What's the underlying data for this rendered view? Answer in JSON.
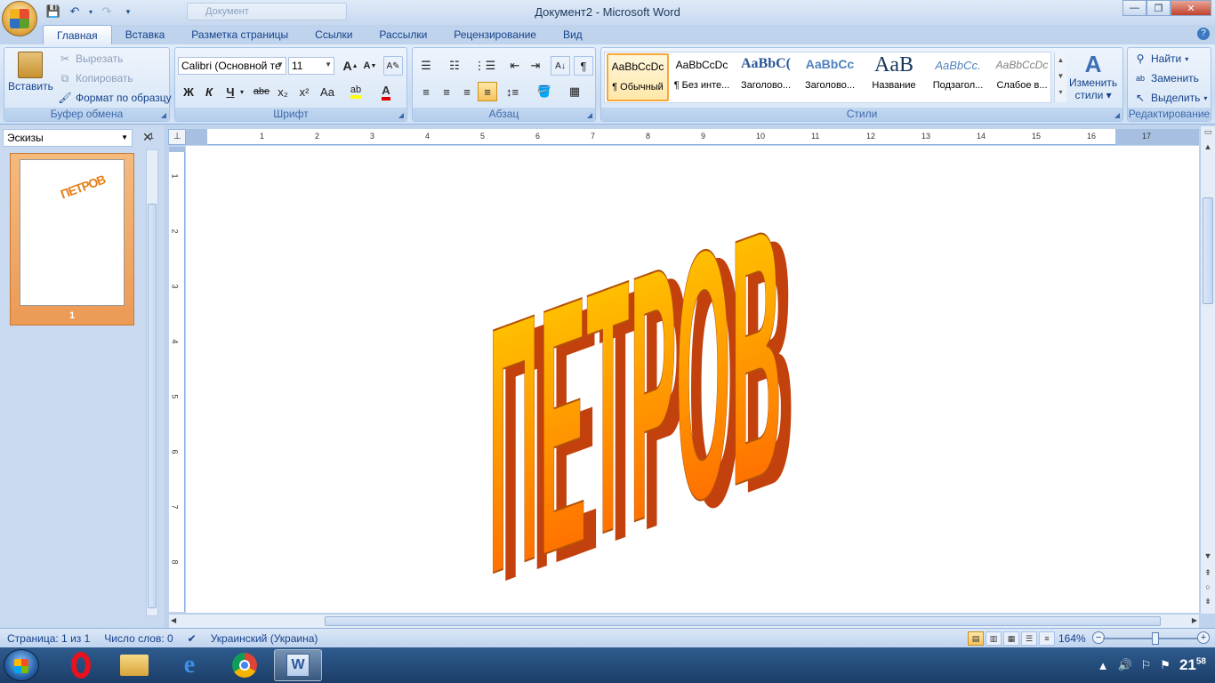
{
  "window": {
    "title": "Документ2 - Microsoft Word",
    "ghost_tab_label": "Документ"
  },
  "ribbon_tabs": [
    "Главная",
    "Вставка",
    "Разметка страницы",
    "Ссылки",
    "Рассылки",
    "Рецензирование",
    "Вид"
  ],
  "clipboard": {
    "paste_label": "Вставить",
    "cut_label": "Вырезать",
    "copy_label": "Копировать",
    "format_painter_label": "Формат по образцу",
    "group_label": "Буфер обмена"
  },
  "font": {
    "font_name": "Calibri (Основной те",
    "font_size": "11",
    "group_label": "Шрифт",
    "bold": "Ж",
    "italic": "К",
    "underline": "Ч",
    "strike": "abe",
    "subscript": "x₂",
    "superscript": "x²",
    "change_case": "Aa",
    "grow": "A",
    "shrink": "A"
  },
  "paragraph": {
    "group_label": "Абзац"
  },
  "styles": {
    "group_label": "Стили",
    "items": [
      {
        "preview": "AaBbCcDc",
        "name": "¶ Обычный"
      },
      {
        "preview": "AaBbCcDc",
        "name": "¶ Без инте..."
      },
      {
        "preview": "AaBbC(",
        "name": "Заголово..."
      },
      {
        "preview": "AaBbCc",
        "name": "Заголово..."
      },
      {
        "preview": "AaB",
        "name": "Название"
      },
      {
        "preview": "AaBbCc.",
        "name": "Подзагол..."
      },
      {
        "preview": "AaBbCcDc",
        "name": "Слабое в..."
      }
    ],
    "change_styles_label_1": "Изменить",
    "change_styles_label_2": "стили"
  },
  "editing": {
    "group_label": "Редактирование",
    "find_label": "Найти",
    "replace_label": "Заменить",
    "select_label": "Выделить"
  },
  "thumbnails_pane": {
    "view_label": "Эскизы",
    "page_number": "1",
    "thumb_text": "ПЕТРОВ"
  },
  "document": {
    "wordart_text": "ПЕТРОВ"
  },
  "ruler": {
    "h_ticks": [
      "1",
      "1",
      "2",
      "3",
      "4",
      "5",
      "6",
      "7",
      "8",
      "9",
      "10",
      "11",
      "12",
      "13",
      "14",
      "15",
      "16",
      "17"
    ],
    "v_ticks": [
      "1",
      "2",
      "3",
      "4",
      "5",
      "6",
      "7",
      "8"
    ]
  },
  "statusbar": {
    "page": "Страница: 1 из 1",
    "words": "Число слов: 0",
    "language": "Украинский (Украина)",
    "zoom": "164%",
    "zoom_level_percent": 164
  },
  "taskbar": {
    "clock_hours": "21",
    "clock_minutes": "58"
  },
  "colors": {
    "wordart_front_top": "#ffd700",
    "wordart_front_bottom": "#ff5a00",
    "wordart_side": "#c2410c",
    "ribbon_accent": "#15428b"
  }
}
